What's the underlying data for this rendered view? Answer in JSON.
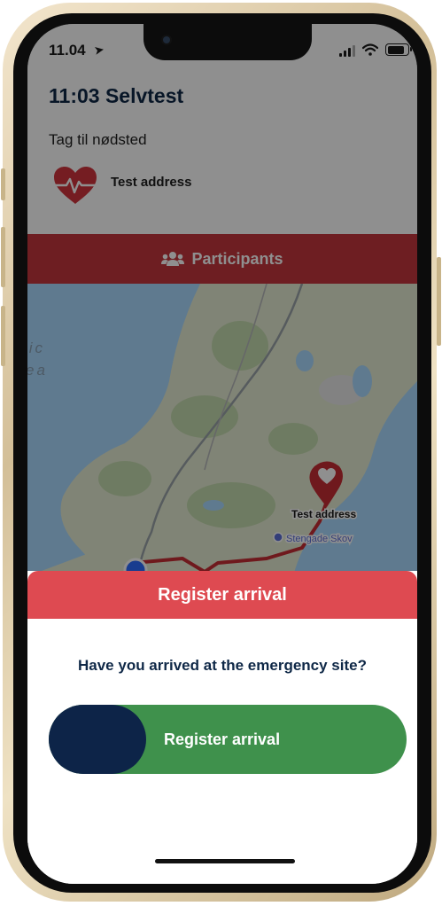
{
  "status_bar": {
    "time": "11.04"
  },
  "header": {
    "title": "11:03 Selvtest",
    "subtitle": "Tag til nødsted",
    "address": "Test address"
  },
  "participants": {
    "label": "Participants"
  },
  "map": {
    "sea_label_line1": "tic",
    "sea_label_line2": "ea",
    "destination_label": "Test address",
    "poi_label": "Stengade Skov"
  },
  "sheet": {
    "header_title": "Register arrival",
    "question": "Have you arrived at the emergency site?",
    "slider_label": "Register arrival"
  },
  "colors": {
    "accent_red": "#de4a51",
    "participants_red": "#c5373d",
    "navy": "#0d2448",
    "green": "#3f914c"
  }
}
